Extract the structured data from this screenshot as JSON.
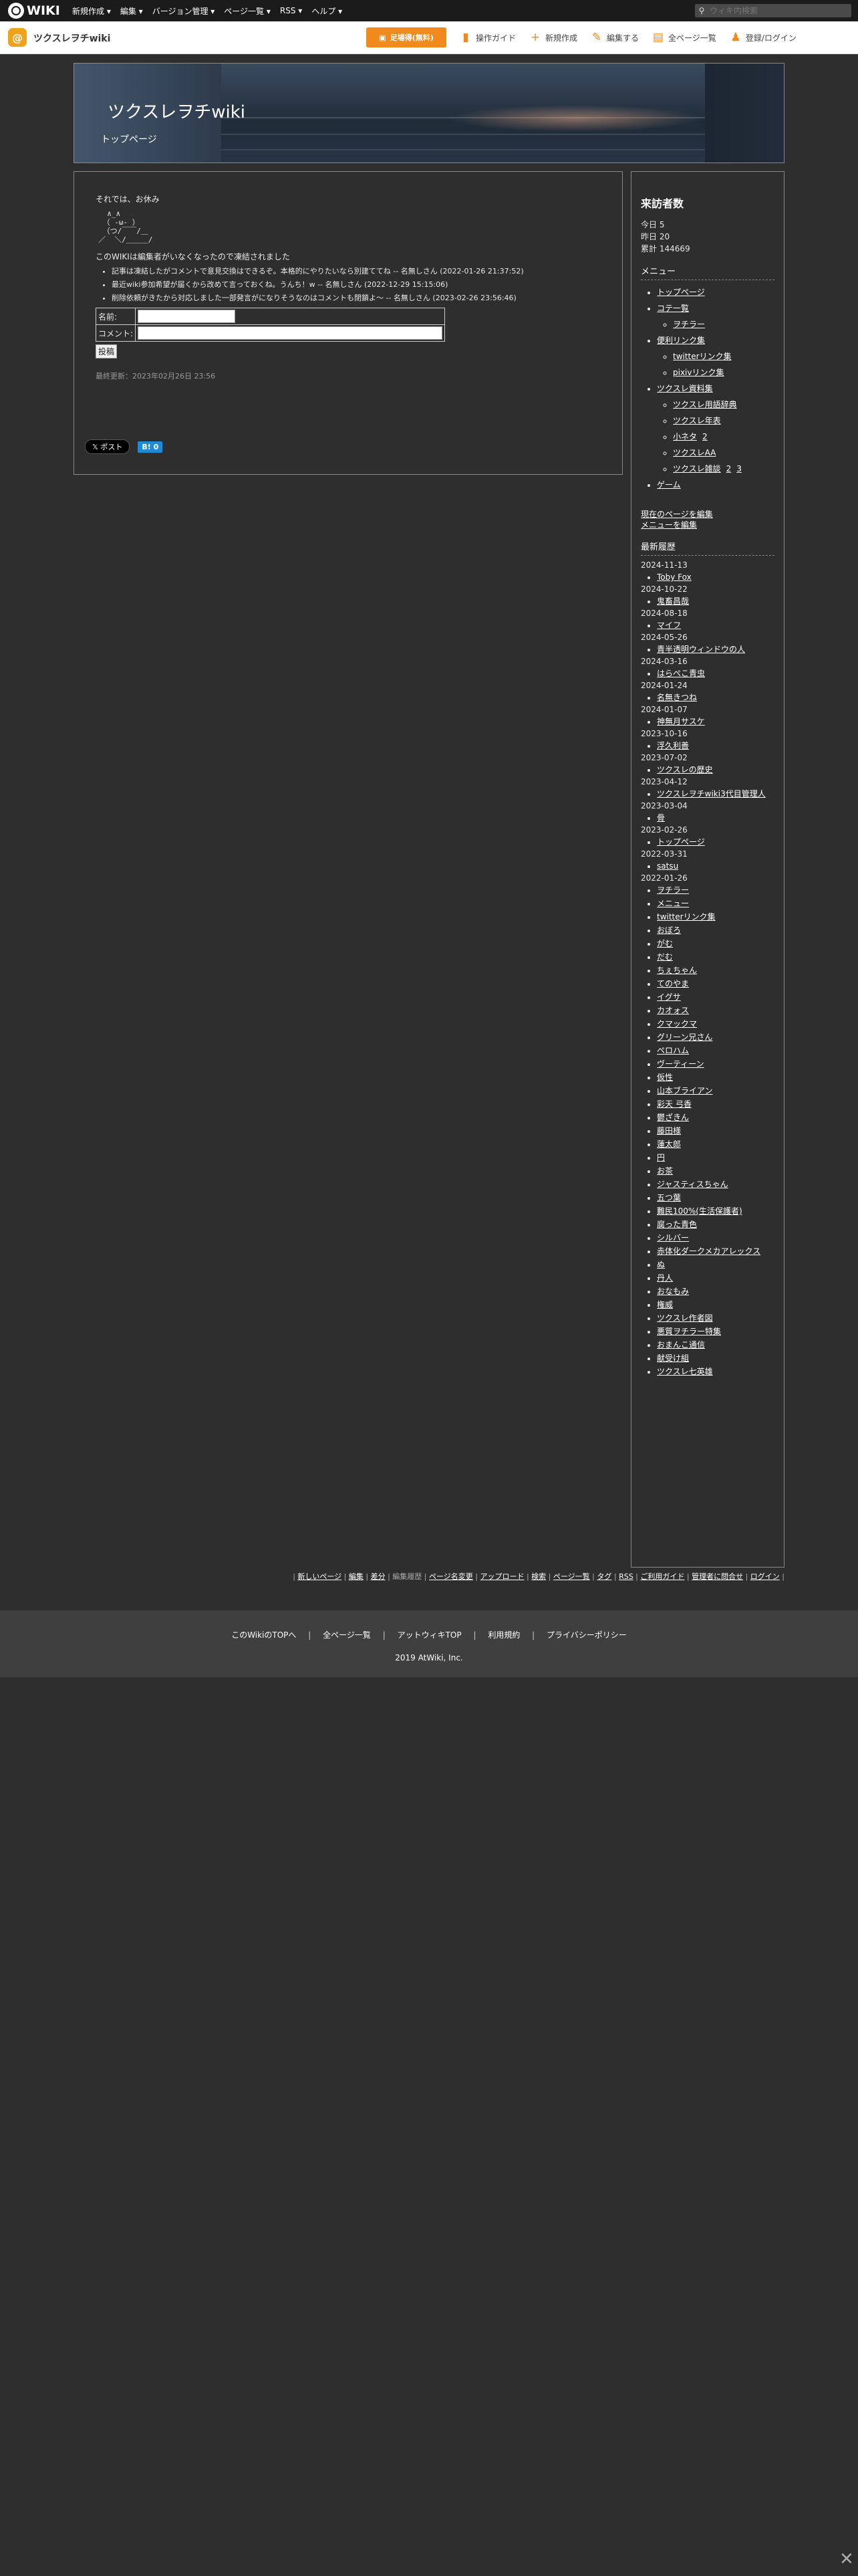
{
  "topbar": {
    "logo_text": "WIKI",
    "menu": [
      "新規作成 ▾",
      "編集 ▾",
      "バージョン管理 ▾",
      "ページ一覧 ▾",
      "RSS ▾",
      "ヘルプ ▾"
    ],
    "search_placeholder": "ウィキ内検索"
  },
  "sitebar": {
    "site_name": "ツクスレヲチwiki",
    "register_label": "足場得(無料)",
    "tools": [
      "操作ガイド",
      "新規作成",
      "編集する",
      "全ページ一覧",
      "登録/ログイン"
    ],
    "accent_color": "#f08a1c"
  },
  "header": {
    "title": "ツクスレヲチwiki",
    "subtitle": "トップページ"
  },
  "main": {
    "greeting": "それでは、お休み",
    "ascii_art": "  ∧_∧\n （ -ω- ）\n （つ/￣￣/＿\n／  ＼/＿＿＿/",
    "notice": "このWIKIは編集者がいなくなったので凍結されました",
    "comments": [
      "記事は凍結したがコメントで意見交換はできるぞ。本格的にやりたいなら別建ててね -- 名無しさん (2022-01-26 21:37:52)",
      "最近wiki参加希望が届くから改めて言っておくね。うんち！w -- 名無しさん (2022-12-29 15:15:06)",
      "削除依頼がきたから対応しました一部発言がになりそうなのはコメントも閉鎖よ～ -- 名無しさん (2023-02-26 23:56:46)"
    ],
    "form": {
      "name_label": "名前:",
      "comment_label": "コメント:",
      "submit_label": "投稿"
    },
    "updated": "最終更新：2023年02月26日 23:56",
    "share": {
      "x_label": "𝕏 ポスト",
      "hatena_label": "B! 0"
    }
  },
  "sidebar": {
    "visitors_title": "来訪者数",
    "stats": [
      "今日 5",
      "昨日 20",
      "累計 144669"
    ],
    "menu_title": "メニュー",
    "menu": [
      {
        "label": "トップページ"
      },
      {
        "label": "コテ一覧",
        "children": [
          {
            "label": "ヲチラー"
          }
        ]
      },
      {
        "label": "便利リンク集",
        "children": [
          {
            "label": "twitterリンク集"
          },
          {
            "label": "pixivリンク集"
          }
        ]
      },
      {
        "label": "ツクスレ資料集",
        "children": [
          {
            "label": "ツクスレ用語辞典"
          },
          {
            "label": "ツクスレ年表"
          },
          {
            "label": "小ネタ",
            "extra": [
              "2"
            ]
          },
          {
            "label": "ツクスレAA"
          },
          {
            "label": "ツクスレ雑談",
            "extra": [
              "2",
              "3"
            ]
          }
        ]
      },
      {
        "label": "ゲーム"
      }
    ],
    "edit_links": [
      "現在のページを編集",
      "メニューを編集"
    ],
    "recent_title": "最新履歴",
    "recent": [
      {
        "date": "2024-11-13",
        "items": [
          "Toby Fox"
        ]
      },
      {
        "date": "2024-10-22",
        "items": [
          "鬼畜昌哉"
        ]
      },
      {
        "date": "2024-08-18",
        "items": [
          "マイフ"
        ]
      },
      {
        "date": "2024-05-26",
        "items": [
          "青半透明ウィンドウの人"
        ]
      },
      {
        "date": "2024-03-16",
        "items": [
          "はらぺこ青虫"
        ]
      },
      {
        "date": "2024-01-24",
        "items": [
          "名無きつね"
        ]
      },
      {
        "date": "2024-01-07",
        "items": [
          "神無月サスケ"
        ]
      },
      {
        "date": "2023-10-16",
        "items": [
          "浮久利善"
        ]
      },
      {
        "date": "2023-07-02",
        "items": [
          "ツクスレの歴史"
        ]
      },
      {
        "date": "2023-04-12",
        "items": [
          "ツクスレヲチwiki3代目管理人"
        ]
      },
      {
        "date": "2023-03-04",
        "items": [
          "骨"
        ]
      },
      {
        "date": "2023-02-26",
        "items": [
          "トップページ"
        ]
      },
      {
        "date": "2022-03-31",
        "items": [
          "satsu"
        ]
      },
      {
        "date": "2022-01-26",
        "items": [
          "ヲチラー",
          "メニュー",
          "twitterリンク集",
          "おぼろ",
          "がむ",
          "だむ",
          "ちぇちゃん",
          "てのやま",
          "イグサ",
          "カオォス",
          "クマックマ",
          "グリーン兄さん",
          "ペロハム",
          "ヴーティーン",
          "仮性",
          "山本ブライアン",
          "彩天 弓香",
          "鬱ざきん",
          "藤田様",
          "蓮太郎",
          "円",
          "お茶",
          "ジャスティスちゃん",
          "五つ葉",
          "難民100%(生活保護者)",
          "腐った青色",
          "シルバー",
          "赤体化ダークメカアレックス",
          "ぬ",
          "丹人",
          "おなもみ",
          "権威",
          "ツクスレ作者図",
          "悪質ヲチラー特集",
          "おまんこ通信",
          "献受け組",
          "ツクスレ七英雄"
        ]
      }
    ]
  },
  "bottom_links": [
    "新しいページ",
    "編集",
    "差分",
    "編集履歴",
    "ページ名変更",
    "アップロード",
    "検索",
    "ページ一覧",
    "タグ",
    "RSS",
    "ご利用ガイド",
    "管理者に問合せ",
    "ログイン"
  ],
  "footer": {
    "links": [
      "このWikiのTOPへ",
      "全ページ一覧",
      "アットウィキTOP",
      "利用規約",
      "プライバシーポリシー"
    ],
    "copyright": "2019 AtWiki, Inc."
  }
}
